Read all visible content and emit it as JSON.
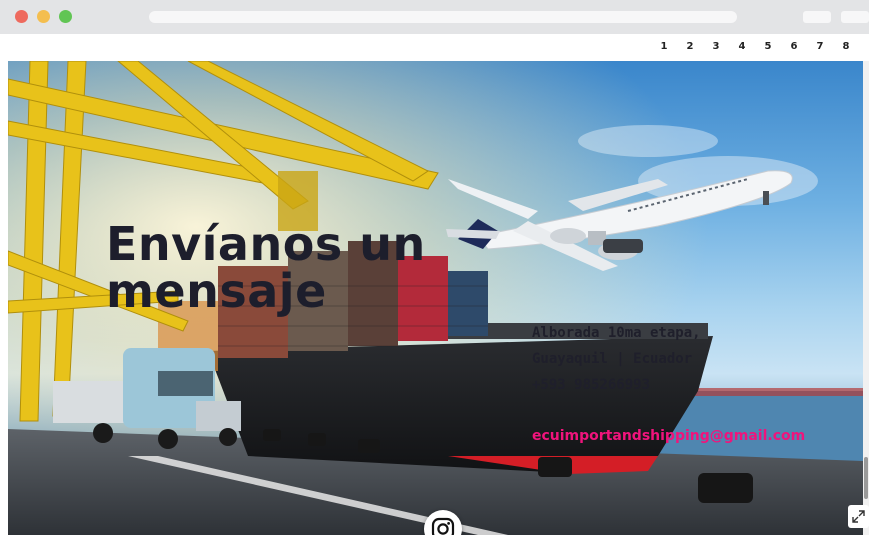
{
  "browser": {
    "traffic_lights": [
      "close",
      "minimize",
      "zoom"
    ],
    "colors": {
      "close": "#ee6a5e",
      "minimize": "#f4be4f",
      "zoom": "#61c554"
    }
  },
  "pagination": [
    "1",
    "2",
    "3",
    "4",
    "5",
    "6",
    "7",
    "8"
  ],
  "hero": {
    "title_line1": "Envíanos un",
    "title_line2": "mensaje",
    "address_line1": "Alborada 10ma etapa,",
    "address_line2": "Guayaquil | Ecuador",
    "phone": "+593 985266993",
    "email": "ecuimportandshipping@gmail.com"
  },
  "icons": {
    "social": "instagram-icon",
    "expand": "expand-icon"
  },
  "colors": {
    "email": "#f0147c",
    "title": "#1d1e2c",
    "crane": "#e8c21a"
  }
}
